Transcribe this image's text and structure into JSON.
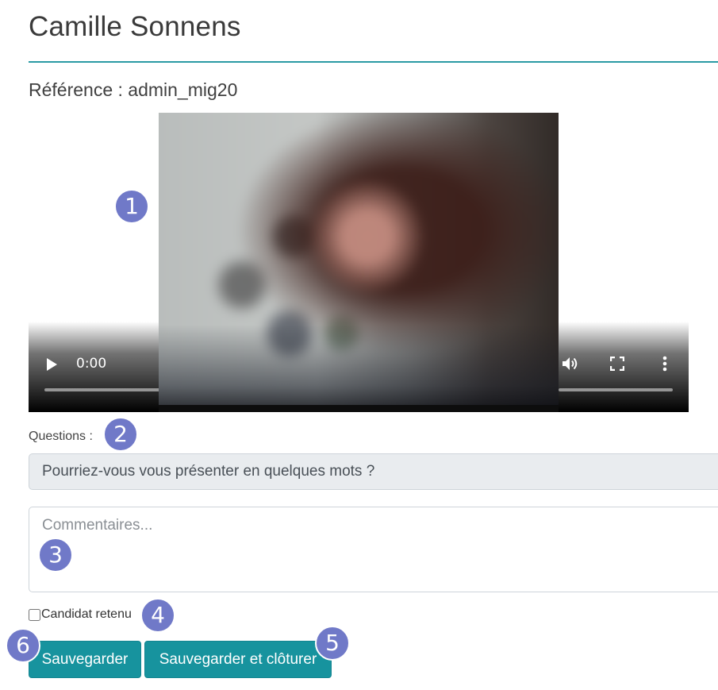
{
  "header": {
    "title": "Camille Sonnens",
    "reference": "Référence : admin_mig20"
  },
  "player": {
    "time": "0:00",
    "icons": [
      "play-icon",
      "volume-icon",
      "fullscreen-icon",
      "more-options-icon"
    ]
  },
  "questions": {
    "label": "Questions :",
    "current": "Pourriez-vous vous présenter en quelques mots ?"
  },
  "comments": {
    "placeholder": "Commentaires..."
  },
  "checkbox": {
    "label": "Candidat retenu",
    "checked": false
  },
  "buttons": {
    "save": "Sauvegarder",
    "save_close": "Sauvegarder et clôturer"
  },
  "callouts": [
    "1",
    "2",
    "3",
    "4",
    "5",
    "6"
  ],
  "colors": {
    "accent": "#17939e",
    "rule": "#2a9aa4",
    "callout": "#7079c8"
  }
}
